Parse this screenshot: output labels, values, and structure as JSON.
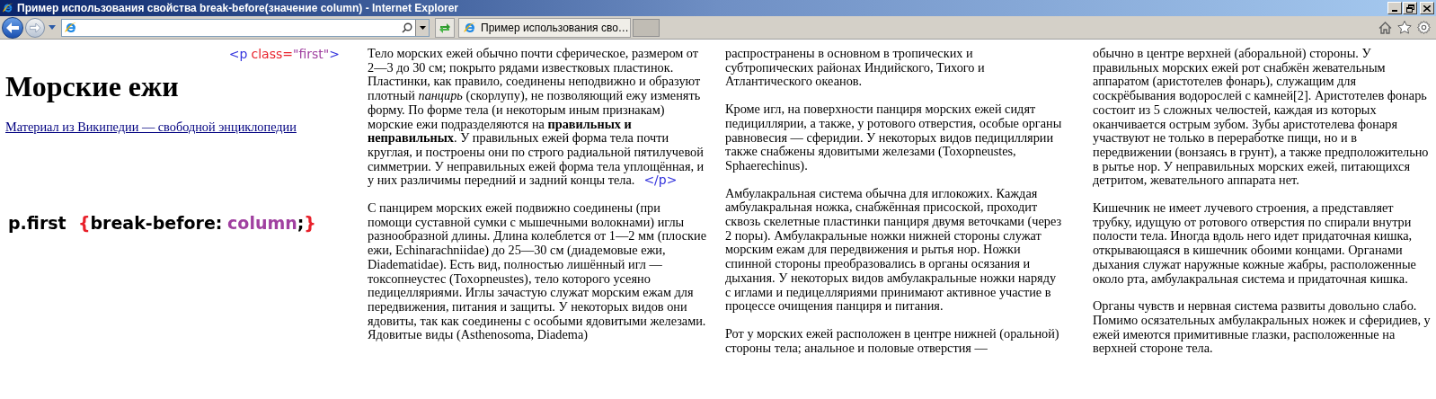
{
  "window": {
    "title": "Пример использования свойства break-before(значение column) - Internet Explorer"
  },
  "tabs": [
    {
      "label": "Пример использования сво…"
    }
  ],
  "page": {
    "open_tag": [
      {
        "text": "<p",
        "color": "#3333dd"
      },
      {
        "text": "class=",
        "color": "#e8202a"
      },
      {
        "text": "\"first\"",
        "color": "#a040a0"
      },
      {
        "text": ">",
        "color": "#3333dd"
      }
    ],
    "heading": "Морские ежи",
    "link": "Материал из Википедии — свободной энциклопедии",
    "css_rule": [
      {
        "text": "p.first",
        "color": "#000000"
      },
      {
        "text": "{",
        "color": "#e8202a"
      },
      {
        "text": "break-before:",
        "color": "#000000"
      },
      {
        "text": "column",
        "color": "#a040a0"
      },
      {
        "text": ";",
        "color": "#000000"
      },
      {
        "text": "}",
        "color": "#e8202a"
      }
    ],
    "columns": [
      [
        {
          "text": "Тело морских ежей обычно почти сферическое, размером от 2—3 до 30 см; покрыто рядами известковых пластинок. Пластинки, как правило, соединены неподвижно и образуют плотный *панцирь* (скорлупу), не позволяющий ежу изменять форму. По форме тела (и некоторым иным признакам) морские ежи подразделяются на **правильных и неправильных**. У правильных ежей форма тела почти круглая, и построены они по строго радиальной пятилучевой симметрии. У неправильных ежей форма тела уплощённая, и у них различимы передний и задний концы тела.",
          "close_tag": "</p>"
        },
        {
          "text": "С панцирем морских ежей подвижно соединены (при помощи суставной сумки с мышечными волокнами) иглы разнообразной длины. Длина колеблется от 1—2 мм (плоские ежи, Echinarachniidae) до 25—30 см (диадемовые ежи, Diadematidae). Есть вид, полностью лишённый игл — токсопнеустес (Toxopneustes), тело которого усеяно педицелляриями. Иглы зачастую служат морским ежам для передвижения, питания и защиты. У некоторых видов они ядовиты, так как соединены с особыми ядовитыми железами. Ядовитые виды (Asthenosoma, Diadema)"
        }
      ],
      [
        {
          "text": "распространены в основном в тропических и субтропических районах Индийского, Тихого и Атлантического океанов."
        },
        {
          "text": "Кроме игл, на поверхности панциря морских ежей сидят педициллярии, а также, у ротового отверстия, особые органы равновесия — сферидии. У некоторых видов педициллярии также снабжены ядовитыми железами (Toxopneustes, Sphaerechinus)."
        },
        {
          "text": "Амбулакральная система обычна для иглокожих. Каждая амбулакральная ножка, снабжённая присоской, проходит сквозь скелетные пластинки панциря двумя веточками (через 2 поры). Амбулакральные ножки нижней стороны служат морским ежам для передвижения и рытья нор. Ножки спинной стороны преобразовались в органы осязания и дыхания. У некоторых видов амбулакральные ножки наряду с иглами и педицелляриями принимают активное участие в процессе очищения панциря и питания."
        },
        {
          "text": "Рот у морских ежей расположен в центре нижней (оральной) стороны тела; анальное и половые отверстия —"
        }
      ],
      [
        {
          "text": "обычно в центре верхней (аборальной) стороны. У правильных морских ежей рот снабжён жевательным аппаратом (аристотелев фонарь), служащим для соскрёбывания водорослей с камней[2]. Аристотелев фонарь состоит из 5 сложных челюстей, каждая из которых оканчивается острым зубом. Зубы аристотелева фонаря участвуют не только в переработке пищи, но и в передвижении (вонзаясь в грунт), а также предположительно в рытье нор. У неправильных морских ежей, питающихся детритом, жевательного аппарата нет."
        },
        {
          "text": "Кишечник не имеет лучевого строения, а представляет трубку, идущую от ротового отверстия по спирали внутри полости тела. Иногда вдоль него идет придаточная кишка, открывающаяся в кишечник обоими концами. Органами дыхания служат наружные кожные жабры, расположенные около рта, амбулакральная система и придаточная кишка."
        },
        {
          "text": "Органы чувств и нервная система развиты довольно слабо. Помимо осязательных амбулакральных ножек и сферидиев, у ежей имеются примитивные глазки, расположенные на верхней стороне тела."
        }
      ]
    ]
  }
}
